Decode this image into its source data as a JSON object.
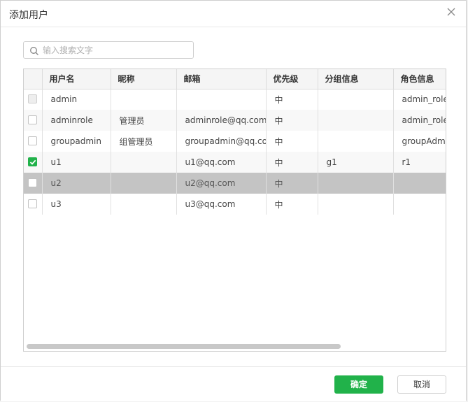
{
  "dialog": {
    "title": "添加用户",
    "close_icon": "close-icon"
  },
  "search": {
    "placeholder": "输入搜索文字",
    "value": "",
    "icon": "search-icon"
  },
  "table": {
    "columns": [
      "用户名",
      "昵称",
      "邮箱",
      "优先级",
      "分组信息",
      "角色信息"
    ],
    "rows": [
      {
        "username": "admin",
        "nickname": "",
        "email": "",
        "priority": "中",
        "group": "",
        "role": "admin_role",
        "checkbox": "disabled"
      },
      {
        "username": "adminrole",
        "nickname": "管理员",
        "email": "adminrole@qq.com",
        "priority": "中",
        "group": "",
        "role": "admin_role",
        "checkbox": "unchecked"
      },
      {
        "username": "groupadmin",
        "nickname": "组管理员",
        "email": "groupadmin@qq.com",
        "priority": "中",
        "group": "",
        "role": "groupAdmin_",
        "checkbox": "unchecked"
      },
      {
        "username": "u1",
        "nickname": "",
        "email": "u1@qq.com",
        "priority": "中",
        "group": "g1",
        "role": "r1",
        "checkbox": "checked"
      },
      {
        "username": "u2",
        "nickname": "",
        "email": "u2@qq.com",
        "priority": "中",
        "group": "",
        "role": "",
        "checkbox": "unchecked"
      },
      {
        "username": "u3",
        "nickname": "",
        "email": "u3@qq.com",
        "priority": "中",
        "group": "",
        "role": "",
        "checkbox": "unchecked"
      }
    ]
  },
  "footer": {
    "ok_label": "确定",
    "cancel_label": "取消"
  },
  "colors": {
    "accent": "#21b24a",
    "selected_row": "#c4c4c4"
  }
}
